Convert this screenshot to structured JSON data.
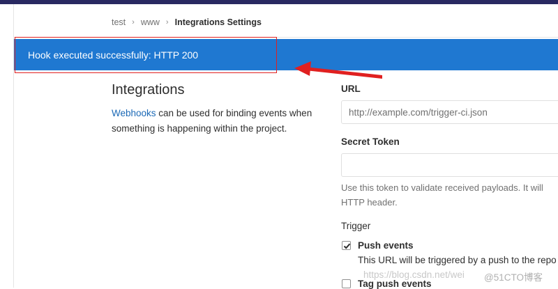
{
  "breadcrumb": {
    "items": [
      "test",
      "www"
    ],
    "current": "Integrations Settings",
    "separator": "›"
  },
  "flash": {
    "message": "Hook executed successfully: HTTP 200",
    "color": "#1f78d1"
  },
  "annotation": {
    "color": "#e02020"
  },
  "integrations": {
    "title": "Integrations",
    "link_text": "Webhooks",
    "description": " can be used for binding events when something is happening within the project."
  },
  "form": {
    "url": {
      "label": "URL",
      "placeholder": "http://example.com/trigger-ci.json"
    },
    "secret_token": {
      "label": "Secret Token",
      "placeholder": "",
      "help_line1": "Use this token to validate received payloads. It will",
      "help_line2": "HTTP header."
    },
    "trigger": {
      "label": "Trigger",
      "events": [
        {
          "label": "Push events",
          "checked": true,
          "description": "This URL will be triggered by a push to the repo"
        },
        {
          "label": "Tag push events",
          "checked": false
        }
      ]
    }
  },
  "watermark": {
    "url": "https://blog.csdn.net/wei",
    "brand": "@51CTO博客"
  }
}
